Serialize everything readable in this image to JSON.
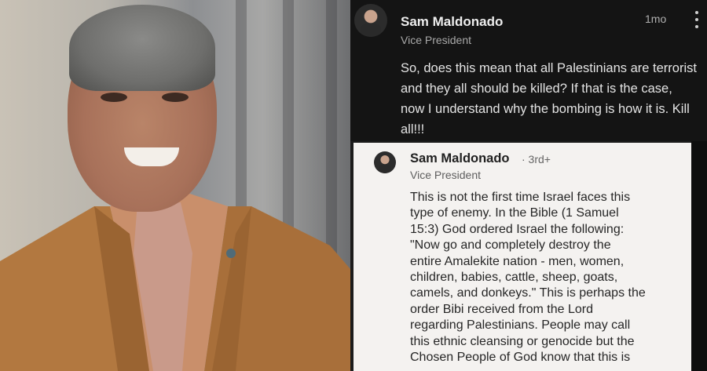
{
  "dark_comment": {
    "author": "Sam Maldonado",
    "title": "Vice President",
    "time": "1mo",
    "body": "So, does this mean that all Palestinians are terrorist and they all should be killed? If that is the case, now I understand why the bombing is how it is. Kill all!!!",
    "menu_icon": "kebab-menu-icon"
  },
  "light_comment": {
    "author": "Sam Maldonado",
    "degree": "· 3rd+",
    "title": "Vice President",
    "body": "This is not the first time Israel faces this\ntype of enemy.  In the Bible (1 Samuel\n15:3) God ordered Israel the following:\n\"Now go and completely destroy the\nentire Amalekite nation - men, women,\nchildren, babies, cattle, sheep, goats,\ncamels, and donkeys.\"  This is perhaps the\norder Bibi received from the Lord\nregarding Palestinians.  People may call\nthis ethnic cleansing or genocide but the\nChosen People of God know that this is"
  },
  "colors": {
    "dark_bg": "#141414",
    "light_bg": "#f4f2f0",
    "suit": "#b27840",
    "tie": "#c99a8a"
  }
}
